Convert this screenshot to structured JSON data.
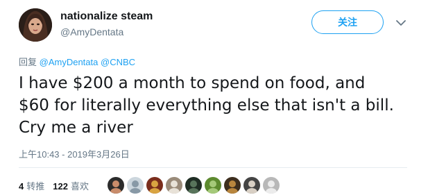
{
  "author": {
    "display_name": "nationalize steam",
    "handle": "@AmyDentata"
  },
  "follow_button": {
    "label": "关注",
    "color": "#1da1f2"
  },
  "reply_to": {
    "prefix": "回复",
    "mentions": [
      "@AmyDentata",
      "@CNBC"
    ]
  },
  "tweet": {
    "lines": [
      "I have $200 a month to spend on food, and",
      "$60 for literally everything else that isn't a bill.",
      "Cry me a river"
    ]
  },
  "timestamp": "上午10:43 - 2019年3月26日",
  "stats": {
    "retweets_count": "4",
    "retweets_label": "转推",
    "likes_count": "122",
    "likes_label": "喜欢"
  },
  "likers": [
    {
      "name": "liker-avatar-1",
      "bg": "#2b2b2b",
      "fg": "#c98c6b"
    },
    {
      "name": "liker-avatar-2",
      "bg": "#ccd6dd",
      "fg": "#8899a6"
    },
    {
      "name": "liker-avatar-3",
      "bg": "#7a2d1c",
      "fg": "#d9a441"
    },
    {
      "name": "liker-avatar-4",
      "bg": "#9a8b7a",
      "fg": "#e8e2d8"
    },
    {
      "name": "liker-avatar-5",
      "bg": "#1f2d24",
      "fg": "#58745b"
    },
    {
      "name": "liker-avatar-6",
      "bg": "#5d8a2f",
      "fg": "#a5c97a"
    },
    {
      "name": "liker-avatar-7",
      "bg": "#3d2e1e",
      "fg": "#b8863e"
    },
    {
      "name": "liker-avatar-8",
      "bg": "#444444",
      "fg": "#d8cfc4"
    },
    {
      "name": "liker-avatar-9",
      "bg": "#b8b8b8",
      "fg": "#ececec"
    }
  ]
}
